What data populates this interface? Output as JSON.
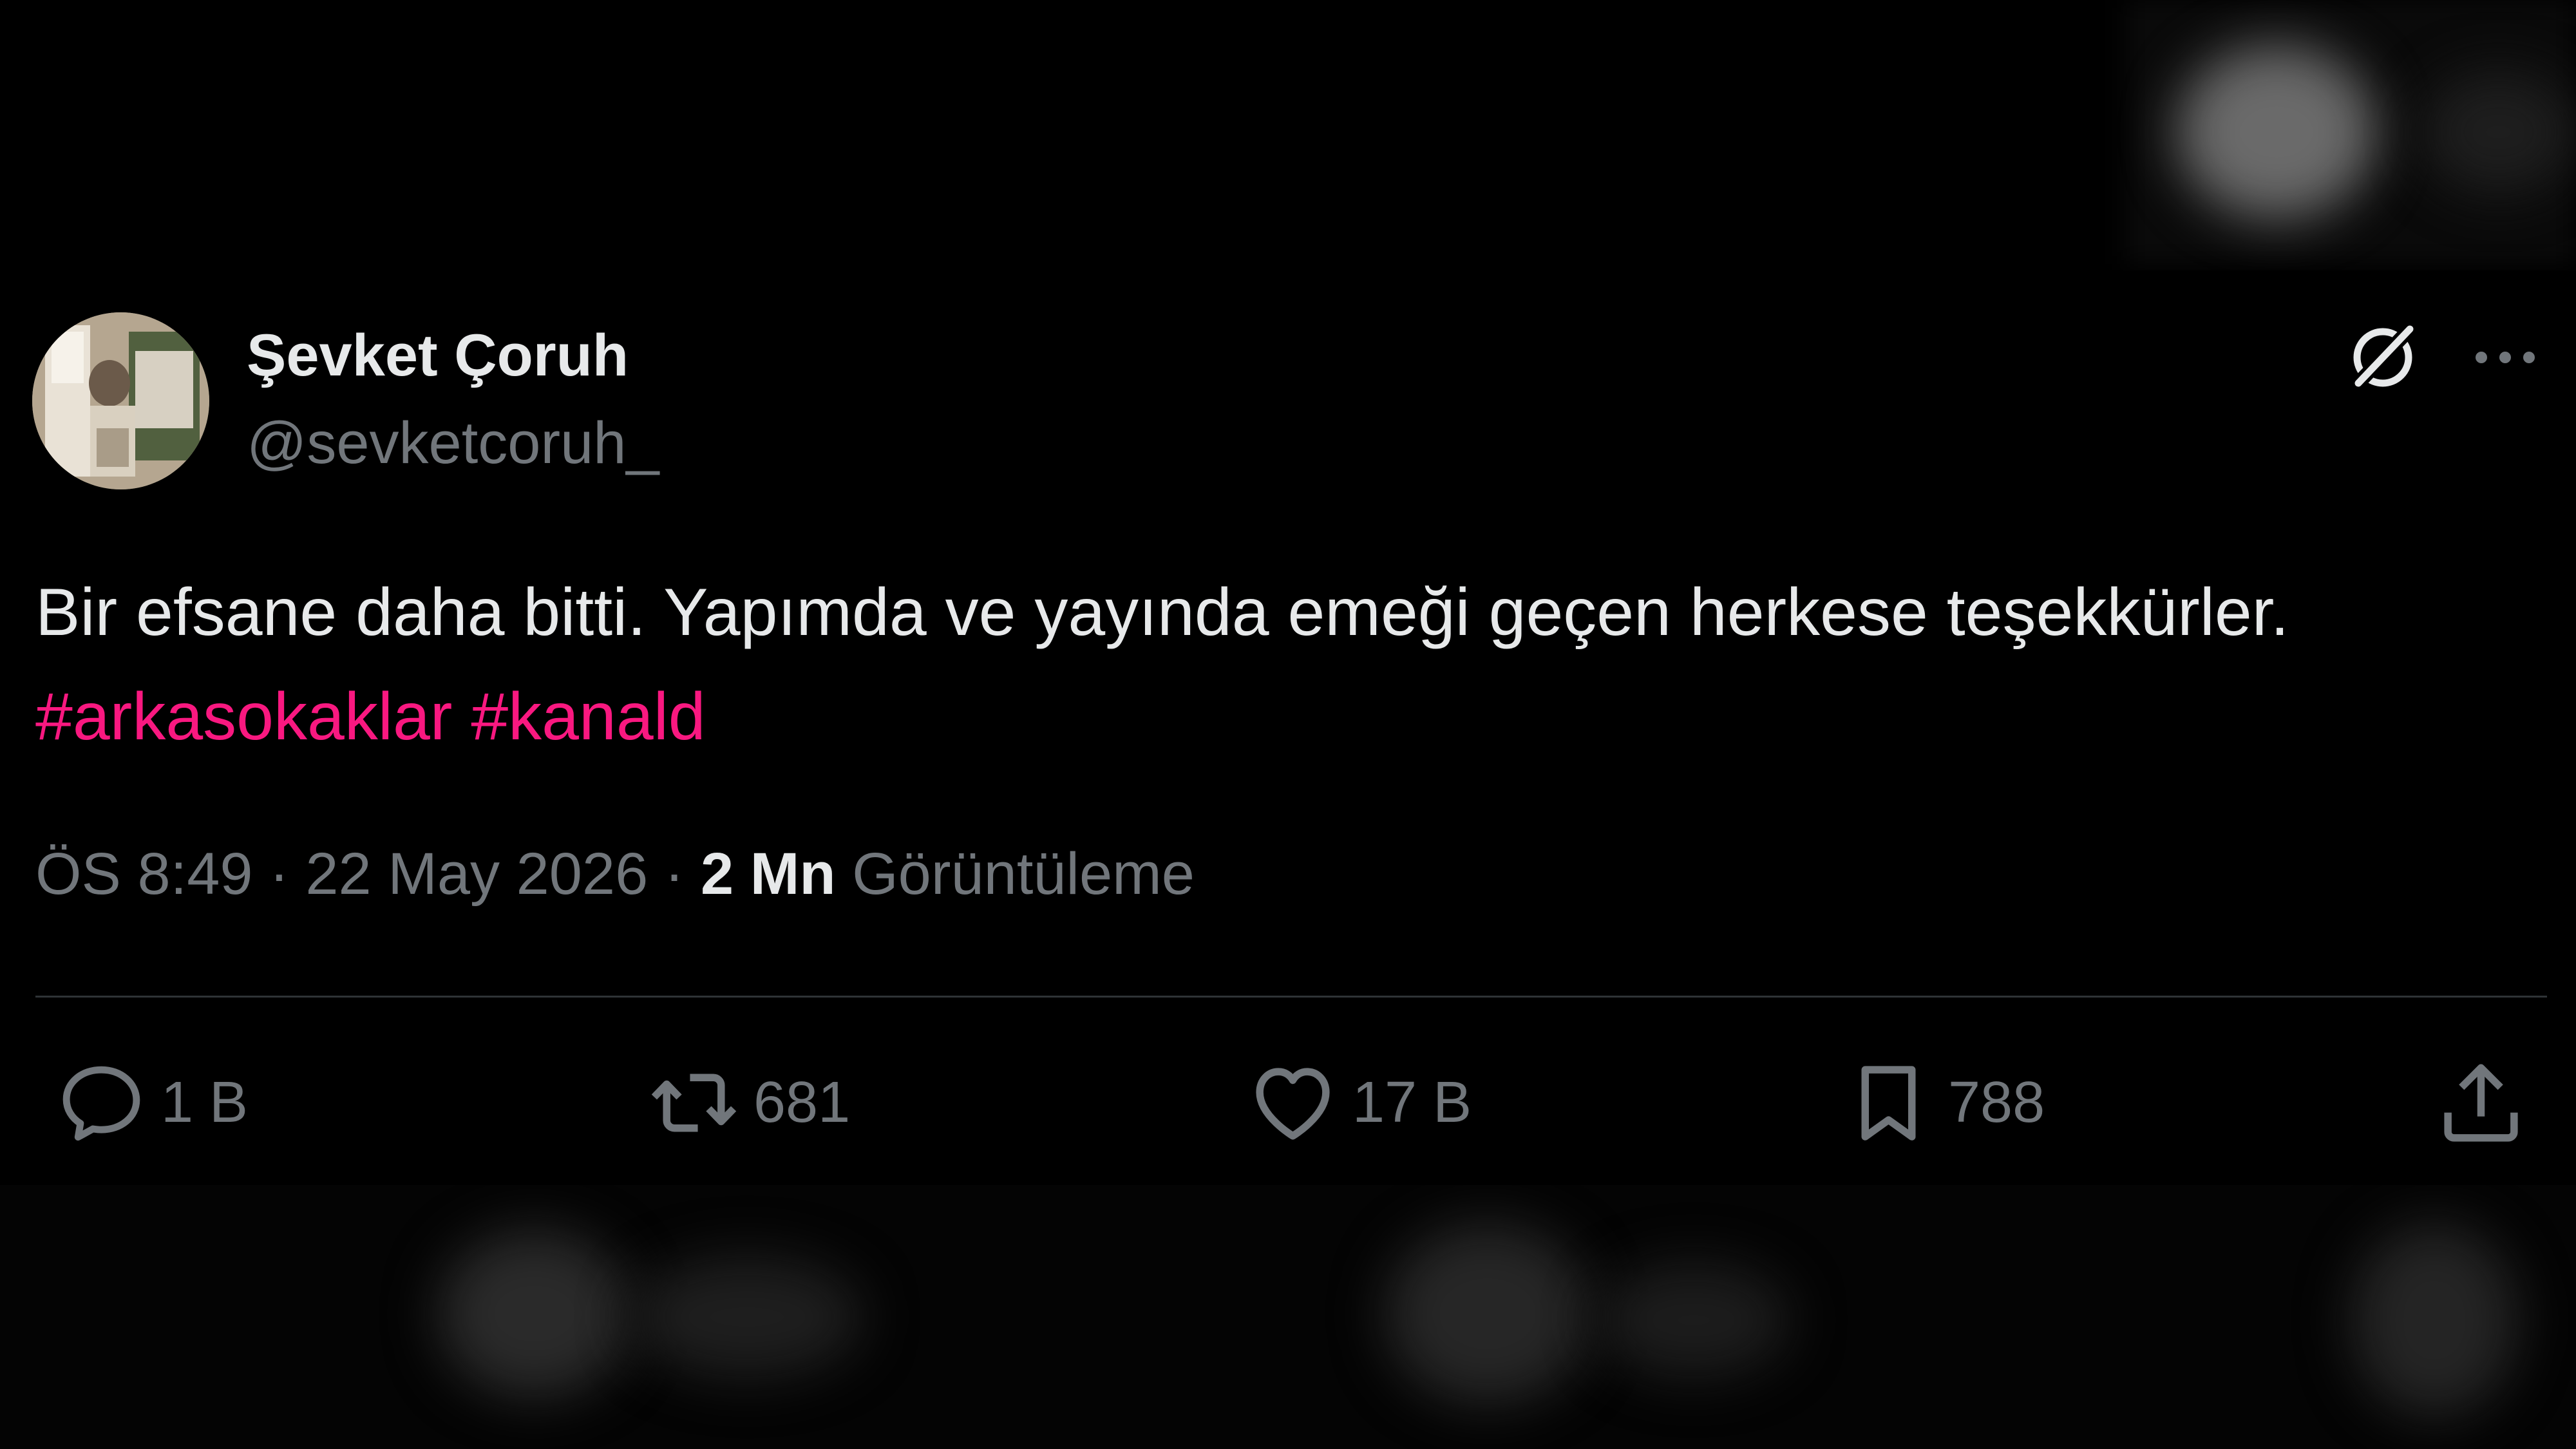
{
  "tweet": {
    "author_name": "Şevket Çoruh",
    "author_handle": "@sevketcoruh_",
    "text_plain": "Bir efsane daha bitti. Yapımda ve yayında emeği geçen herkese teşekkürler. ",
    "hashtags": [
      "#arkasokaklar",
      "#kanald"
    ],
    "time": "ÖS 8:49",
    "date": "22 May 2026",
    "separator": "·",
    "views_count": "2 Mn",
    "views_label": "Görüntüleme"
  },
  "actions": {
    "replies": "1 B",
    "reposts": "681",
    "likes": "17 B",
    "bookmarks": "788"
  },
  "colors": {
    "background": "#000000",
    "text_primary": "#e7e9ea",
    "text_secondary": "#71767b",
    "hashtag": "#f91880",
    "divider": "#2f3336"
  },
  "icons": [
    "grok-icon",
    "more-icon",
    "reply-icon",
    "repost-icon",
    "like-icon",
    "bookmark-icon",
    "share-icon"
  ]
}
